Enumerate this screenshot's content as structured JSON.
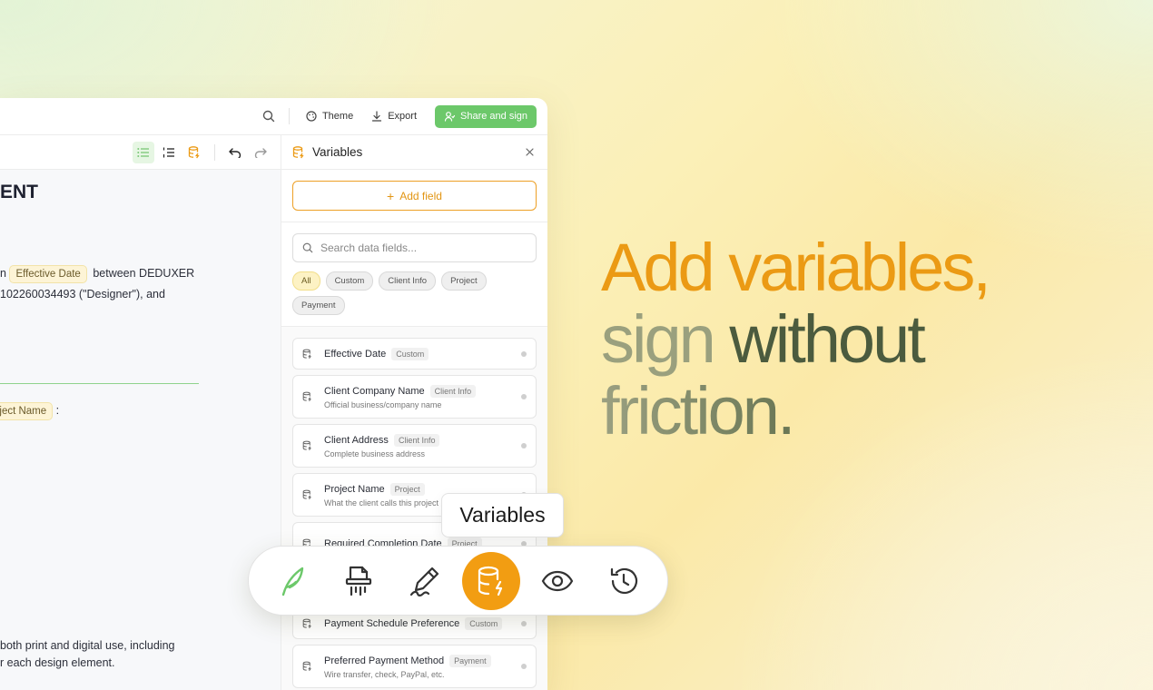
{
  "topbar": {
    "theme_label": "Theme",
    "export_label": "Export",
    "share_label": "Share and sign"
  },
  "document": {
    "heading": "ENT",
    "line1_prefix": "n",
    "line1_chip": "Effective Date",
    "line1_suffix": "between DEDUXER",
    "line2": "102260034493 (\"Designer\"), and",
    "line3_chip": "oject Name",
    "line3_suffix": ":",
    "line4": "both print and digital use, including",
    "line5": "r each design element."
  },
  "panel": {
    "title": "Variables",
    "add_field_label": "Add field",
    "search_placeholder": "Search data fields...",
    "filters": [
      "All",
      "Custom",
      "Client Info",
      "Project",
      "Payment"
    ],
    "variables": [
      {
        "name": "Effective Date",
        "tag": "Custom",
        "desc": ""
      },
      {
        "name": "Client Company Name",
        "tag": "Client Info",
        "desc": "Official business/company name"
      },
      {
        "name": "Client Address",
        "tag": "Client Info",
        "desc": "Complete business address"
      },
      {
        "name": "Project Name",
        "tag": "Project",
        "desc": "What the client calls this project"
      },
      {
        "name": "Required Completion Date",
        "tag": "Project",
        "desc": ""
      },
      {
        "name": "Payment Schedule Preference",
        "tag": "Custom",
        "desc": ""
      },
      {
        "name": "Preferred Payment Method",
        "tag": "Payment",
        "desc": "Wire transfer, check, PayPal, etc."
      }
    ]
  },
  "dock": {
    "tooltip": "Variables",
    "items": [
      "feather-icon",
      "shredder-icon",
      "signature-pen-icon",
      "database-icon",
      "eye-icon",
      "history-icon"
    ],
    "active_color": "#f29d12"
  },
  "headline": {
    "line1": "Add variables,",
    "line2_a": "sign",
    "line2_b": "without",
    "line3": "friction."
  },
  "colors": {
    "accent_orange": "#eb9a14",
    "share_green": "#6cc86a"
  }
}
